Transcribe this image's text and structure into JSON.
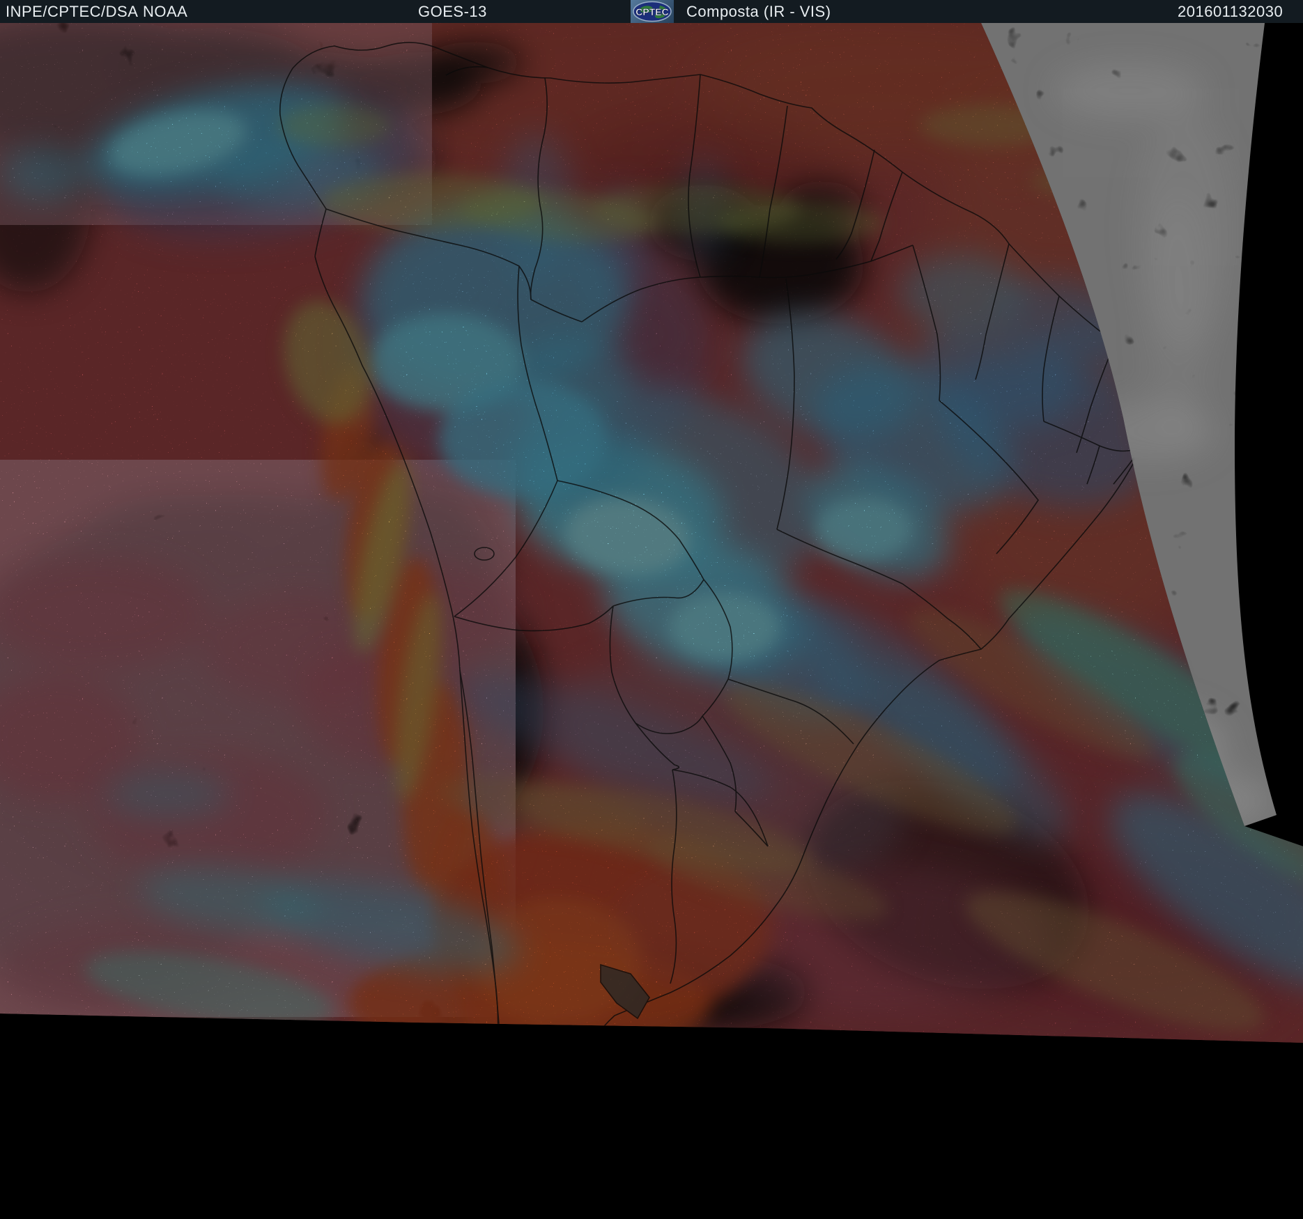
{
  "header": {
    "source": "INPE/CPTEC/DSA",
    "agency": "NOAA",
    "satellite": "GOES-13",
    "product": "Composta (IR - VIS)",
    "timestamp": "201601132030",
    "logo": {
      "text": "CPTEC"
    }
  },
  "palette": {
    "header_bg": "#131b21",
    "header_text": "#e9eef1",
    "warm_ir_red": "#b94e4d",
    "hot_surface_orange": "#e8622f",
    "cold_cloud_cyan": "#7fe8ff",
    "mid_cloud_blue": "#4d7fcc",
    "thin_cloud_green": "#b6cc66",
    "tan_cirrus": "#c2985c",
    "pink_lowcloud": "#c75f70",
    "visible_only_gray": "#8f8f8f",
    "space_black": "#000000",
    "border_line": "#0a0a0a"
  }
}
